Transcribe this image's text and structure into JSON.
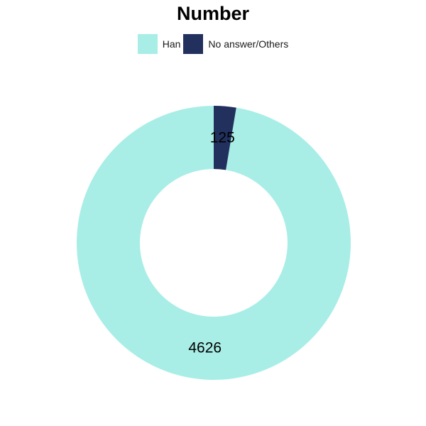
{
  "chart_data": {
    "type": "pie",
    "subtype": "donut",
    "title": "Number",
    "categories": [
      "Han",
      "No answer/Others"
    ],
    "values": [
      4626,
      125
    ],
    "colors": [
      "#A8EEE6",
      "#22305E"
    ],
    "data_labels": [
      "4626",
      "125"
    ],
    "legend": {
      "position": "top",
      "entries": [
        "Han",
        "No answer/Others"
      ]
    },
    "start_angle": "12 o'clock",
    "direction": "counter-clockwise",
    "grid": false
  }
}
